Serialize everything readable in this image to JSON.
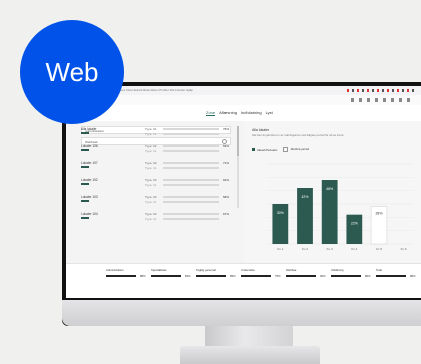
{
  "badge": {
    "label": "Web"
  },
  "mac_menu": {
    "items": "Chrome  Arkiv  Redigera  Visa  Historik  Bokmärken  Profiler  Flik  Fönster  Hjälp"
  },
  "tabs": [
    {
      "label": "Zone",
      "active": true
    },
    {
      "label": "Aflæsning",
      "active": false
    },
    {
      "label": "Indhöstning",
      "active": false
    },
    {
      "label": "Lyst",
      "active": false
    }
  ],
  "filters": {
    "first": "Administration",
    "second": "Webbsøk"
  },
  "rows": [
    {
      "label": "Alla lokaler",
      "qty": "Type: 01",
      "qty2": "Type: 11",
      "p1": 0.76,
      "p2": 0.62,
      "pct": "76%"
    },
    {
      "label": "Lokaler 106",
      "qty": "Type: 02",
      "qty2": "Type: 11",
      "p1": 0.69,
      "p2": 0.55,
      "pct": "69%"
    },
    {
      "label": "Lokaler 107",
      "qty": "Type: 02",
      "qty2": "Type: 11",
      "p1": 0.71,
      "p2": 0.48,
      "pct": "71%"
    },
    {
      "label": "Lokaler 102",
      "qty": "Type: 03",
      "qty2": "Type: 11",
      "p1": 0.64,
      "p2": 0.52,
      "pct": "64%"
    },
    {
      "label": "Lokaler 103",
      "qty": "Type: 02",
      "qty2": "Type: 11",
      "p1": 0.58,
      "p2": 0.42,
      "pct": "58%"
    },
    {
      "label": "Lokaler 104",
      "qty": "Type: 02",
      "qty2": "Type: 11",
      "p1": 0.67,
      "p2": 0.59,
      "pct": "67%"
    }
  ],
  "chart_panel": {
    "title": "Alla lokaler",
    "subtitle": "Här kan du jämföra en av mätningarna med tidigare period för att se trend.",
    "legend": [
      "Aktuell Perioden",
      "Jämföra period"
    ]
  },
  "chart_data": {
    "type": "bar",
    "categories": [
      "Kv 1",
      "Kv 2",
      "Kv 3",
      "Kv 4",
      "Kv 5",
      "Kv 6"
    ],
    "series": [
      {
        "values": [
          30,
          42,
          48,
          22,
          0,
          0
        ]
      },
      {
        "values": [
          0,
          0,
          0,
          0,
          28,
          0
        ]
      }
    ],
    "data_labels": [
      "30%",
      "42%",
      "48%",
      "22%",
      "28%",
      ""
    ],
    "colors": [
      "#2c5a50",
      "#ffffff"
    ]
  },
  "footer": [
    {
      "label": "Administration",
      "pct": "88%"
    },
    {
      "label": "Specialklass",
      "pct": "83%"
    },
    {
      "label": "Tagblg personal",
      "pct": "89%"
    },
    {
      "label": "Undersöka",
      "pct": "75%"
    },
    {
      "label": "Webbsø",
      "pct": "92%"
    },
    {
      "label": "Utbildning",
      "pct": "86%"
    },
    {
      "label": "Total",
      "pct": "86%"
    }
  ],
  "colors": {
    "accent": "#2c5a50",
    "badge": "#0052e8"
  }
}
